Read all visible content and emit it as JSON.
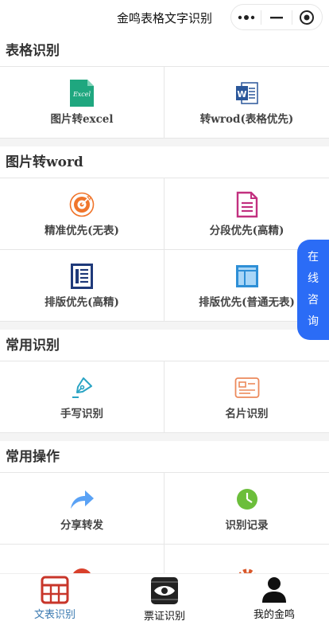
{
  "header": {
    "title": "金鸣表格文字识别"
  },
  "capsule": {
    "more_icon": "more-dots-icon",
    "minimize_icon": "minimize-icon",
    "close_icon": "target-close-icon"
  },
  "sections": [
    {
      "title": "表格识别",
      "items": [
        {
          "label": "图片转excel",
          "icon": "excel-icon"
        },
        {
          "label": "转wrod(表格优先)",
          "icon": "word-icon"
        }
      ]
    },
    {
      "title": "图片转word",
      "items": [
        {
          "label": "精准优先(无表)",
          "icon": "target-icon"
        },
        {
          "label": "分段优先(高精)",
          "icon": "document-icon"
        },
        {
          "label": "排版优先(高精)",
          "icon": "layout-list-icon"
        },
        {
          "label": "排版优先(普通无表)",
          "icon": "layout-icon"
        }
      ]
    },
    {
      "title": "常用识别",
      "items": [
        {
          "label": "手写识别",
          "icon": "pen-icon"
        },
        {
          "label": "名片识别",
          "icon": "business-card-icon"
        }
      ]
    },
    {
      "title": "常用操作",
      "items": [
        {
          "label": "分享转发",
          "icon": "share-icon"
        },
        {
          "label": "识别记录",
          "icon": "clock-icon"
        }
      ]
    }
  ],
  "float_button": {
    "chars": [
      "在",
      "线",
      "咨",
      "询"
    ]
  },
  "tabs": [
    {
      "label": "文表识别",
      "icon": "table-grid-icon",
      "active": true
    },
    {
      "label": "票证识别",
      "icon": "ticket-eye-icon",
      "active": false
    },
    {
      "label": "我的金鸣",
      "icon": "user-icon",
      "active": false
    }
  ],
  "colors": {
    "accent_blue": "#2b6cf6",
    "active_tab": "#3a79b0",
    "excel_green": "#1fa77f",
    "word_blue": "#2b579a",
    "target_orange": "#f0752b",
    "doc_pink": "#c2307f",
    "navy": "#1f3a7a",
    "layout_blue": "#2e8fd6",
    "pen_teal": "#2aa4c4",
    "card_orange": "#ec8a5c",
    "share_blue": "#5aa2f5",
    "clock_green": "#6cbe3b",
    "tab_red": "#c8362a"
  }
}
